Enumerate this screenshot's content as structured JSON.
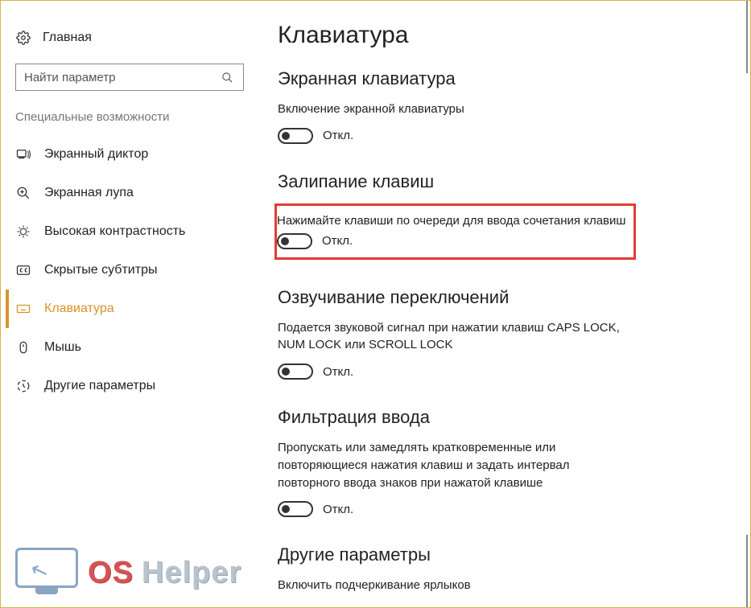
{
  "sidebar": {
    "home_label": "Главная",
    "search_placeholder": "Найти параметр",
    "category": "Специальные возможности",
    "items": [
      {
        "label": "Экранный диктор"
      },
      {
        "label": "Экранная лупа"
      },
      {
        "label": "Высокая контрастность"
      },
      {
        "label": "Скрытые субтитры"
      },
      {
        "label": "Клавиатура"
      },
      {
        "label": "Мышь"
      },
      {
        "label": "Другие параметры"
      }
    ]
  },
  "main": {
    "title": "Клавиатура",
    "sections": {
      "onscreen": {
        "title": "Экранная клавиатура",
        "desc": "Включение экранной клавиатуры",
        "state": "Откл."
      },
      "sticky": {
        "title": "Залипание клавиш",
        "desc": "Нажимайте клавиши по очереди для ввода сочетания клавиш",
        "state": "Откл."
      },
      "togglekeys": {
        "title": "Озвучивание переключений",
        "desc": "Подается звуковой сигнал при нажатии клавиш CAPS LOCK, NUM LOCK или SCROLL LOCK",
        "state": "Откл."
      },
      "filter": {
        "title": "Фильтрация ввода",
        "desc": "Пропускать или замедлять кратковременные или повторяющиеся нажатия клавиш и задать интервал повторного ввода знаков при нажатой клавише",
        "state": "Откл."
      },
      "other": {
        "title": "Другие параметры",
        "desc": "Включить подчеркивание ярлыков"
      }
    }
  },
  "watermark": {
    "os": "OS",
    "helper": "Helper"
  }
}
